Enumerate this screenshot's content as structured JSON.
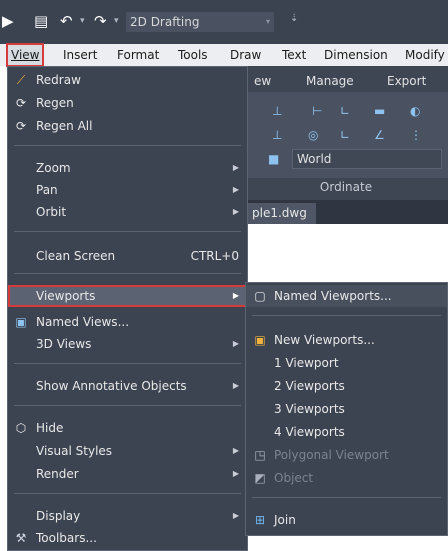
{
  "qat": {
    "workspace": "2D Drafting",
    "icons": [
      "app-icon",
      "print-icon",
      "undo-icon",
      "redo-icon",
      "dropdown-icon"
    ]
  },
  "menubar": {
    "items": [
      "View",
      "Insert",
      "Format",
      "Tools",
      "Draw",
      "Text",
      "Dimension",
      "Modify"
    ]
  },
  "ribbon": {
    "tabs": [
      "ew",
      "Manage",
      "Export"
    ],
    "ucs_label": "World",
    "panel_label": "Ordinate"
  },
  "document_tab": "ple1.dwg",
  "view_menu": {
    "items": [
      {
        "label": "Redraw",
        "icon": "redraw-icon"
      },
      {
        "label": "Regen",
        "icon": "regen-icon"
      },
      {
        "label": "Regen All",
        "icon": "regen-all-icon"
      },
      {
        "label": "Zoom",
        "submenu": true
      },
      {
        "label": "Pan",
        "submenu": true
      },
      {
        "label": "Orbit",
        "submenu": true
      },
      {
        "label": "Clean Screen",
        "shortcut": "CTRL+0"
      },
      {
        "label": "Viewports",
        "submenu": true,
        "selected": true
      },
      {
        "label": "Named Views...",
        "icon": "named-views-icon"
      },
      {
        "label": "3D Views",
        "submenu": true
      },
      {
        "label": "Show Annotative Objects",
        "submenu": true
      },
      {
        "label": "Hide",
        "icon": "hide-icon"
      },
      {
        "label": "Visual Styles",
        "submenu": true
      },
      {
        "label": "Render",
        "submenu": true
      },
      {
        "label": "Display",
        "submenu": true
      },
      {
        "label": "Toolbars...",
        "icon": "toolbars-icon"
      }
    ]
  },
  "viewports_submenu": {
    "items": [
      {
        "label": "Named Viewports...",
        "icon": "named-viewports-icon"
      },
      {
        "label": "New Viewports...",
        "icon": "new-viewports-icon"
      },
      {
        "label": "1 Viewport"
      },
      {
        "label": "2 Viewports"
      },
      {
        "label": "3 Viewports"
      },
      {
        "label": "4 Viewports"
      },
      {
        "label": "Polygonal Viewport",
        "icon": "polygonal-viewport-icon",
        "disabled": true
      },
      {
        "label": "Object",
        "icon": "object-icon",
        "disabled": true
      },
      {
        "label": "Join",
        "icon": "join-icon"
      }
    ]
  },
  "colors": {
    "menu_bg": "#3d4451",
    "highlight_outline": "#d63b3b",
    "menubar_bg": "#edeef1"
  }
}
